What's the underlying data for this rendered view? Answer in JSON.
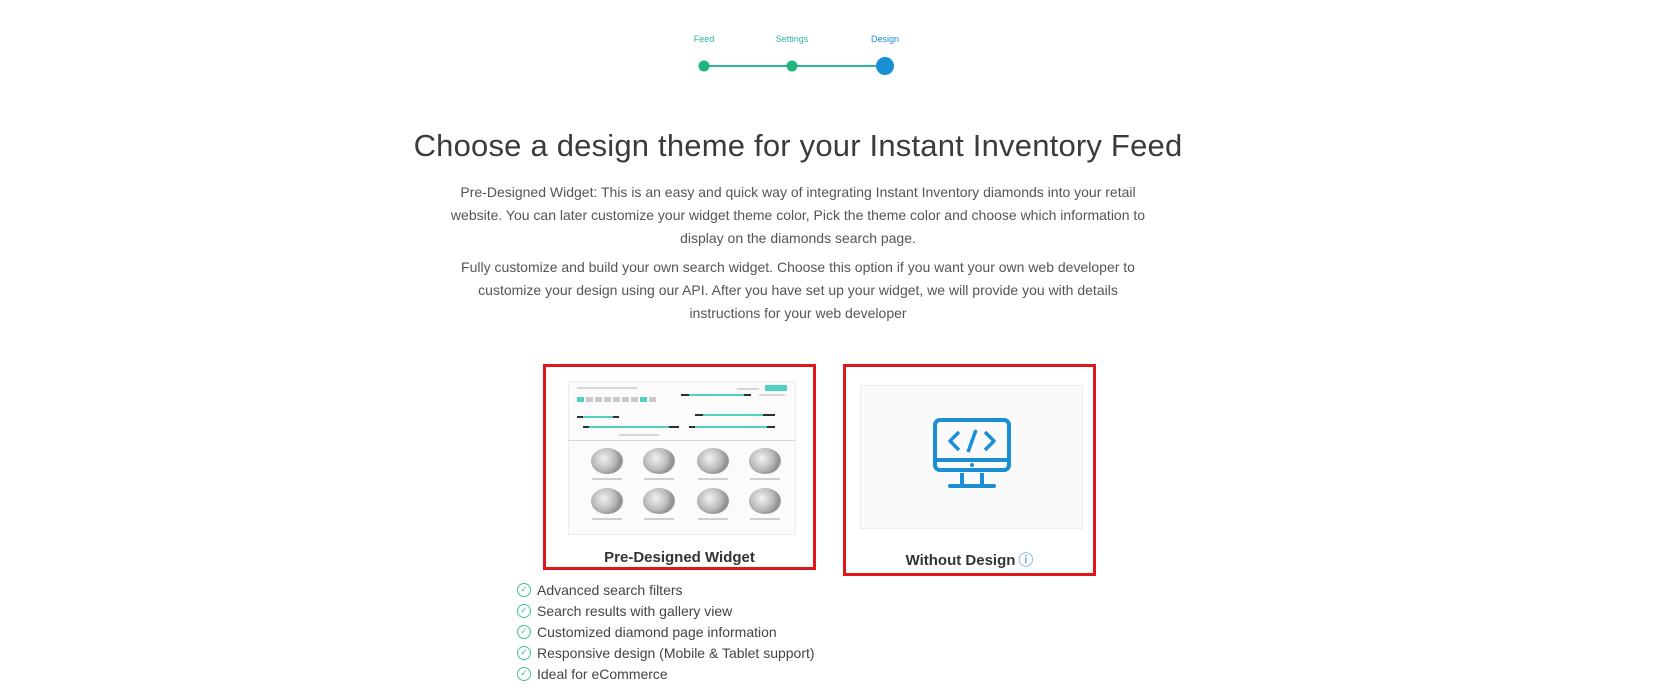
{
  "stepper": {
    "steps": [
      {
        "label": "Feed"
      },
      {
        "label": "Settings"
      },
      {
        "label": "Design"
      }
    ]
  },
  "header": {
    "title": "Choose a design theme for your Instant Inventory Feed"
  },
  "descriptions": {
    "predesigned": "Pre-Designed Widget: This is an easy and quick way of integrating Instant Inventory diamonds into your retail website. You can later customize your widget theme color, Pick the theme color and choose which information to display on the diamonds search page.",
    "custom": "Fully customize and build your own search widget. Choose this option if you want your own web developer to customize your design using our API. After you have set up your widget, we will provide you with details instructions for your web developer"
  },
  "options": {
    "predesigned": {
      "label": "Pre-Designed Widget"
    },
    "without_design": {
      "label": "Without Design",
      "info_icon": "info-circle-icon"
    }
  },
  "features": [
    "Advanced search filters",
    "Search results with gallery view",
    "Customized diamond page information",
    "Responsive design (Mobile & Tablet support)",
    "Ideal for eCommerce"
  ],
  "colors": {
    "accent_teal": "#2bb69a",
    "active_blue": "#1a8fd6",
    "selection_red": "#e0161c"
  }
}
